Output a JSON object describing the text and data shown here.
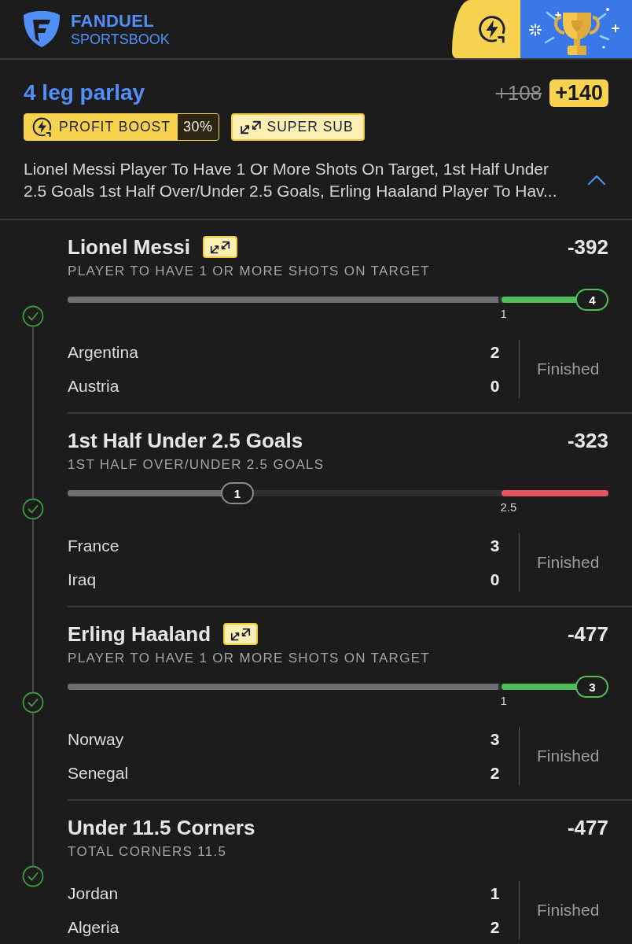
{
  "brand": {
    "name": "FANDUEL",
    "product": "SPORTSBOOK"
  },
  "parlay": {
    "title": "4 leg parlay",
    "original_odds": "+108",
    "odds": "+140",
    "boosts": [
      {
        "kind": "profit_boost",
        "label": "PROFIT BOOST",
        "value": "30%"
      },
      {
        "kind": "super_sub",
        "label": "SUPER SUB"
      }
    ],
    "description": "Lionel Messi Player To Have 1 Or More Shots On Target, 1st Half Under 2.5 Goals 1st Half Over/Under 2.5 Goals, Erling Haaland Player To Hav...",
    "expanded": true
  },
  "legs": [
    {
      "selection": "Lionel Messi",
      "super_sub": true,
      "odds": "-392",
      "market": "PLAYER TO HAVE 1 OR MORE SHOTS ON TARGET",
      "won": true,
      "progress": {
        "kind": "over",
        "level": 0.97,
        "reading": "4",
        "line": "1"
      },
      "teams": [
        {
          "name": "Argentina",
          "score": "2"
        },
        {
          "name": "Austria",
          "score": "0"
        }
      ],
      "status": "Finished"
    },
    {
      "selection": "1st Half Under 2.5 Goals",
      "super_sub": false,
      "odds": "-323",
      "market": "1ST HALF OVER/UNDER 2.5 GOALS",
      "won": true,
      "progress": {
        "kind": "under",
        "level": 0.314,
        "reading": "1",
        "line": "2.5"
      },
      "teams": [
        {
          "name": "France",
          "score": "3"
        },
        {
          "name": "Iraq",
          "score": "0"
        }
      ],
      "status": "Finished"
    },
    {
      "selection": "Erling Haaland",
      "super_sub": true,
      "odds": "-477",
      "market": "PLAYER TO HAVE 1 OR MORE SHOTS ON TARGET",
      "won": true,
      "progress": {
        "kind": "over",
        "level": 0.97,
        "reading": "3",
        "line": "1"
      },
      "teams": [
        {
          "name": "Norway",
          "score": "3"
        },
        {
          "name": "Senegal",
          "score": "2"
        }
      ],
      "status": "Finished"
    },
    {
      "selection": "Under 11.5 Corners",
      "super_sub": false,
      "odds": "-477",
      "market": "TOTAL CORNERS 11.5",
      "won": true,
      "teams": [
        {
          "name": "Jordan",
          "score": "1"
        },
        {
          "name": "Algeria",
          "score": "2"
        }
      ],
      "status": "Finished"
    }
  ]
}
